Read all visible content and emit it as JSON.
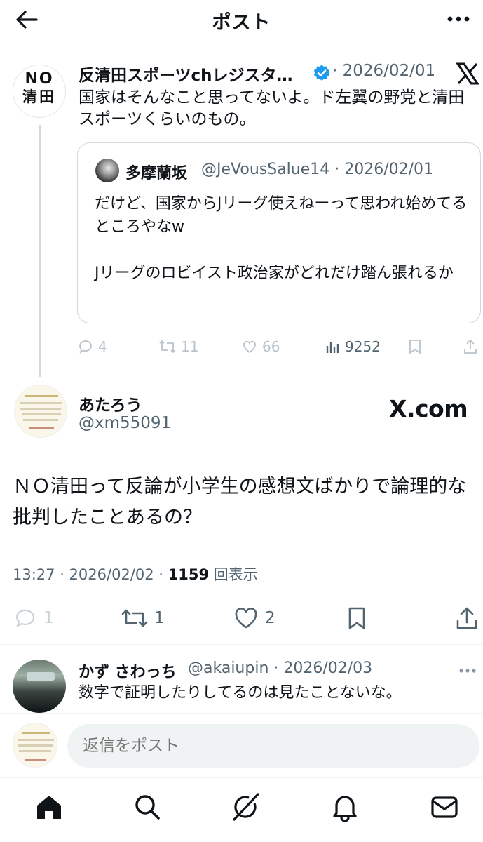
{
  "header": {
    "title": "ポスト",
    "back_icon": "arrow-left-icon",
    "more_icon": "more-vertical-icon"
  },
  "parent_tweet": {
    "avatar_text_line1": "NO",
    "avatar_text_line2": "清田",
    "display_name": "反清田スポーツchレジスタ…",
    "verified": true,
    "meta": "· 2026/02/01",
    "text": "国家はそんなこと思ってないよ。ド左翼の野党と清田スポーツくらいのもの。",
    "quoted": {
      "display_name": "多摩蘭坂",
      "meta": "@JeVousSalue14 · 2026/02/01",
      "text": "だけど、国家からJリーグ使えねーって思われ始めてるところやなw\n\nJリーグのロビイスト政治家がどれだけ踏ん張れるか"
    },
    "actions": {
      "replies": "4",
      "reposts": "11",
      "likes": "66",
      "views": "9252"
    }
  },
  "main_tweet": {
    "display_name": "あたろう",
    "handle": "@xm55091",
    "source_logo": "X.com",
    "text": "ＮＯ清田って反論が小学生の感想文ばかりで論理的な批判したことあるの？",
    "time": "13:27 · 2026/02/02 · ",
    "views_count": "1159",
    "views_label": " 回表示",
    "actions": {
      "replies": "1",
      "reposts": "1",
      "likes": "2"
    }
  },
  "reply": {
    "display_name": "かず さわっち",
    "meta": "@akaiupin · 2026/02/03",
    "text": "数字で証明したりしてるのは見たことないな。"
  },
  "compose": {
    "placeholder": "返信をポスト"
  },
  "bottom_nav": {
    "items": [
      "home-icon",
      "search-icon",
      "grok-icon",
      "notifications-icon",
      "messages-icon"
    ]
  },
  "colors": {
    "text": "#0f1419",
    "muted": "#536471",
    "verified": "#1d9bf0",
    "border": "#cfd9de"
  }
}
